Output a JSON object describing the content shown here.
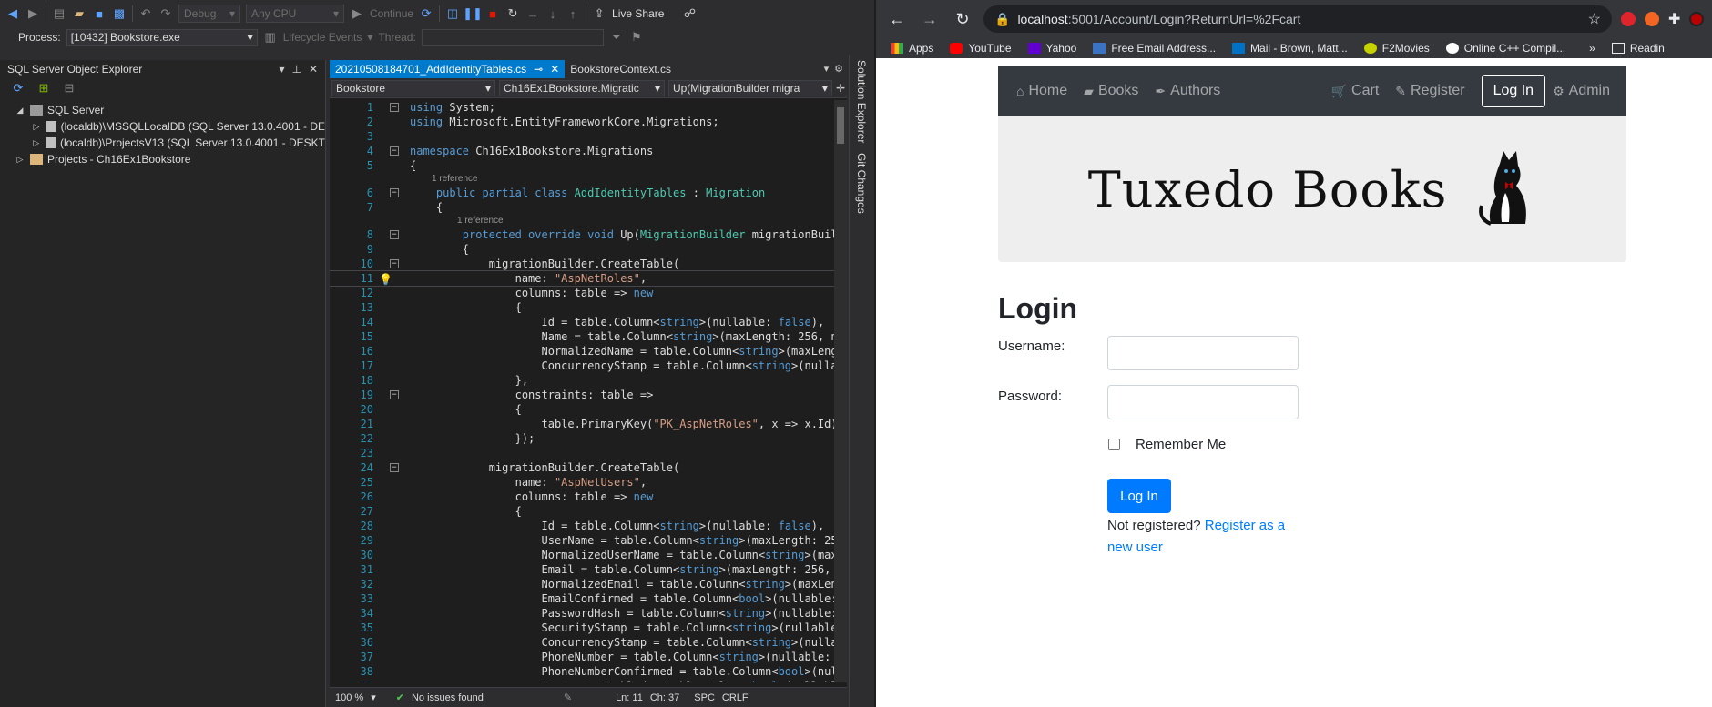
{
  "vs": {
    "toolbar": {
      "config": "Debug",
      "platform": "Any CPU",
      "continue_label": "Continue",
      "live_share": "Live Share"
    },
    "toolbar2": {
      "process_label": "Process:",
      "process_value": "[10432] Bookstore.exe",
      "lifecycle": "Lifecycle Events",
      "thread_label": "Thread:"
    },
    "sso": {
      "title": "SQL Server Object Explorer",
      "tree": [
        {
          "label": "SQL Server",
          "expanded": true
        },
        {
          "label": "(localdb)\\MSSQLLocalDB (SQL Server 13.0.4001 - DE",
          "expanded": false
        },
        {
          "label": "(localdb)\\ProjectsV13 (SQL Server 13.0.4001 - DESKT",
          "expanded": false
        },
        {
          "label": "Projects - Ch16Ex1Bookstore",
          "expanded": false
        }
      ]
    },
    "editor": {
      "tab_active": "20210508184701_AddIdentityTables.cs",
      "tab_inactive": "BookstoreContext.cs",
      "nav_project": "Bookstore",
      "nav_class": "Ch16Ex1Bookstore.Migratic",
      "nav_member": "Up(MigrationBuilder migra",
      "ref_text": "1 reference",
      "zoom": "100 %",
      "issues": "No issues found",
      "ln": "Ln: 11",
      "ch": "Ch: 37",
      "spc": "SPC",
      "crlf": "CRLF"
    },
    "rail": {
      "solution_explorer": "Solution Explorer",
      "git_changes": "Git Changes"
    }
  },
  "browser": {
    "url_host": "localhost",
    "url_rest": ":5001/Account/Login?ReturnUrl=%2Fcart",
    "bookmarks": [
      "Apps",
      "YouTube",
      "Yahoo",
      "Free Email Address...",
      "Mail - Brown, Matt...",
      "F2Movies",
      "Online C++ Compil...",
      "Readin"
    ],
    "nav": {
      "home": "Home",
      "books": "Books",
      "authors": "Authors",
      "cart": "Cart",
      "register": "Register",
      "login": "Log In",
      "admin": "Admin"
    },
    "logo": "Tuxedo Books",
    "heading": "Login",
    "username_label": "Username:",
    "password_label": "Password:",
    "remember_label": "Remember Me",
    "login_button": "Log In",
    "not_registered": "Not registered?",
    "register_link": "Register as a new user"
  }
}
